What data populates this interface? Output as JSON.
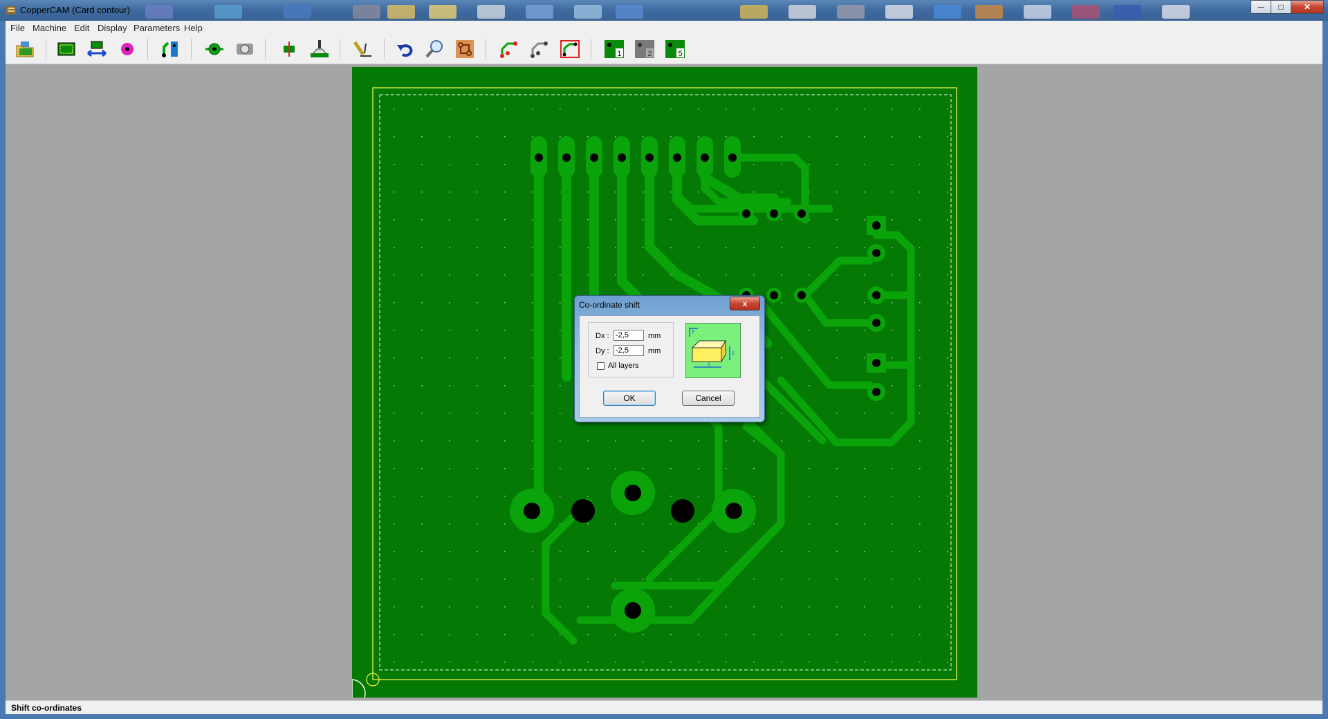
{
  "window": {
    "title": "CopperCAM  (Card contour)",
    "buttons": {
      "minimize": "─",
      "maximize": "□",
      "close": "✕"
    }
  },
  "menu": [
    {
      "label": "File"
    },
    {
      "label": "Machine"
    },
    {
      "label": "Edit"
    },
    {
      "label": "Display"
    },
    {
      "label": "Parameters"
    },
    {
      "label": "Help"
    }
  ],
  "toolbar": {
    "icons": [
      "open-file-icon",
      "card-contour-icon",
      "mirror-icon",
      "drill-point-icon",
      "tracks-icon",
      "pad-icon",
      "hole-icon",
      "center-icon",
      "mill-icon",
      "engrave-icon",
      "undo-icon",
      "zoom-icon",
      "copper-view-icon",
      "path-icon",
      "path-grey-icon",
      "path-frame-icon",
      "layer-1-icon",
      "layer-2-icon",
      "layer-5-icon"
    ],
    "layer_labels": [
      "1",
      "2",
      "5"
    ]
  },
  "dialog": {
    "title": "Co-ordinate shift",
    "close_label": "x",
    "dx_label": "Dx :",
    "dx_value": "-2,5",
    "dy_label": "Dy :",
    "dy_value": "-2,5",
    "unit": "mm",
    "all_layers_label": "All layers",
    "all_layers_checked": false,
    "ok_label": "OK",
    "cancel_label": "Cancel",
    "axis_x": "x",
    "axis_y": "y",
    "axis_z": "z"
  },
  "status": {
    "text": "Shift co-ordinates"
  },
  "colors": {
    "board": "#047a04",
    "track": "#0aa40a",
    "outline": "#ffff44",
    "hole": "#000000",
    "workarea": "#a5a5a5"
  }
}
